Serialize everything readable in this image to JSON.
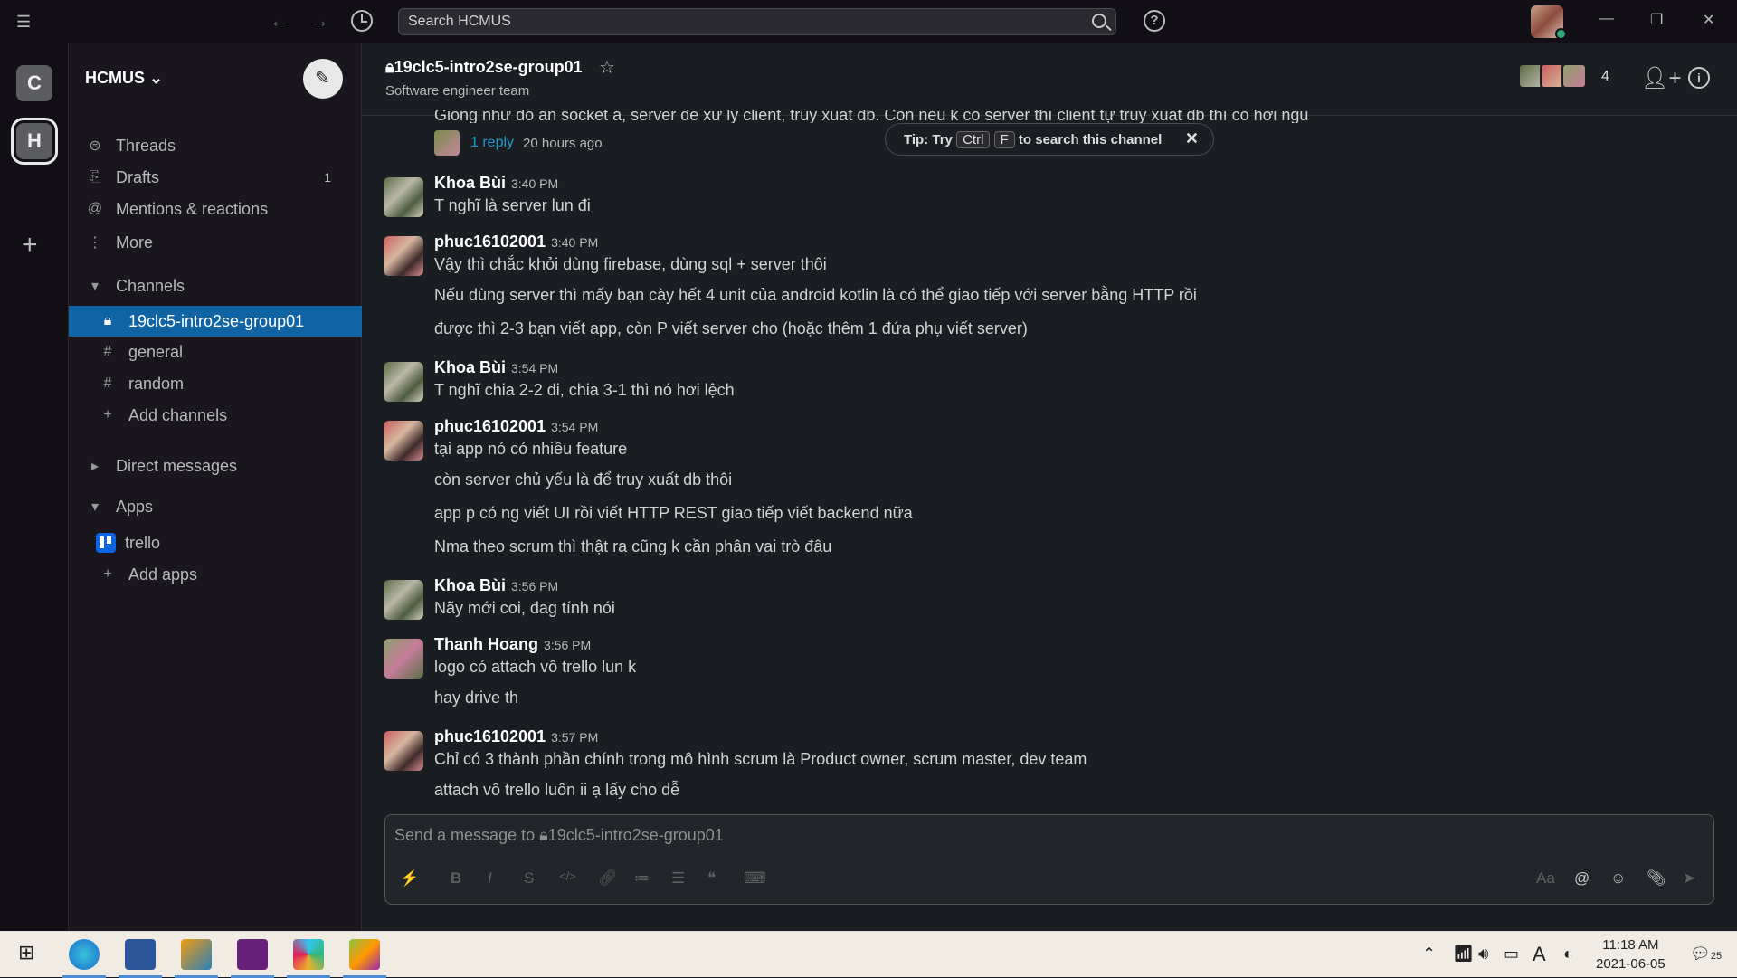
{
  "window": {
    "search_placeholder": "Search HCMUS",
    "nav_back": "←",
    "nav_forward": "→",
    "help": "?",
    "minimize": "—",
    "restore": "❐",
    "close": "✕"
  },
  "rail": {
    "workspaces": [
      {
        "letter": "C"
      },
      {
        "letter": "H",
        "active": true
      }
    ],
    "add": "+"
  },
  "sidebar": {
    "workspace_name": "HCMUS ⌄",
    "nav": [
      {
        "icon": "threads-icon",
        "glyph": "⊜",
        "label": "Threads"
      },
      {
        "icon": "drafts-icon",
        "glyph": "⎘",
        "label": "Drafts",
        "count": "1"
      },
      {
        "icon": "mentions-icon",
        "glyph": "@",
        "label": "Mentions & reactions"
      },
      {
        "icon": "more-icon",
        "glyph": "⋮",
        "label": "More"
      }
    ],
    "channels_header": "Channels",
    "channels": [
      {
        "prefix": "🔒︎",
        "name": "19clc5-intro2se-group01",
        "selected": true
      },
      {
        "prefix": "#",
        "name": "general"
      },
      {
        "prefix": "#",
        "name": "random"
      },
      {
        "prefix": "+",
        "name": "Add channels"
      }
    ],
    "dm_header": "Direct messages",
    "apps_header": "Apps",
    "apps": [
      {
        "name": "trello"
      },
      {
        "name": "Add apps"
      }
    ]
  },
  "channel": {
    "title": "19clc5-intro2se-group01",
    "subtitle": "Software engineer team",
    "member_count": "4",
    "star": "☆"
  },
  "thread_preview": {
    "cut_text": "Giống như đó ấn socket ấ, server để xử lý client, truy xuất db. Còn nếu k có server thì client tự truy xuất db thì có hơi ngu",
    "reply_link": "1 reply",
    "reply_time": "20 hours ago"
  },
  "tip": {
    "prefix": "Tip: Try",
    "key1": "Ctrl",
    "key2": "F",
    "suffix": "to search this channel",
    "close": "✕"
  },
  "messages": [
    {
      "author": "Khoa Bùi",
      "time": "3:40 PM",
      "lines": [
        "T nghĩ là server lun đi"
      ]
    },
    {
      "author": "phuc16102001",
      "time": "3:40 PM",
      "lines": [
        "Vậy thì chắc khỏi dùng firebase, dùng sql + server thôi",
        "Nếu dùng server thì mấy bạn cày hết 4 unit của android kotlin là có thể giao tiếp với server bằng HTTP rồi",
        "được thì 2-3 bạn viết app, còn P viết server cho (hoặc thêm 1 đứa phụ viết server)"
      ]
    },
    {
      "author": "Khoa Bùi",
      "time": "3:54 PM",
      "lines": [
        "T nghĩ chia 2-2 đi, chia 3-1 thì nó hơi lệch"
      ]
    },
    {
      "author": "phuc16102001",
      "time": "3:54 PM",
      "lines": [
        "tại app nó có nhiều feature",
        "còn server chủ yếu là để truy xuất db thôi",
        "app p có ng viết UI rồi viết HTTP REST giao tiếp viết backend nữa",
        "Nma theo scrum thì thật ra cũng k cần phân vai trò đâu"
      ]
    },
    {
      "author": "Khoa Bùi",
      "time": "3:56 PM",
      "lines": [
        "Nãy mới coi, đag tính nói"
      ]
    },
    {
      "author": "Thanh Hoang",
      "time": "3:56 PM",
      "lines": [
        "logo có attach vô trello lun k",
        "hay drive th"
      ]
    },
    {
      "author": "phuc16102001",
      "time": "3:57 PM",
      "lines": [
        "Chỉ có 3 thành phần chính trong mô hình scrum là Product owner, scrum master, dev team",
        "attach vô trello luôn ii ạ lấy cho dễ"
      ]
    }
  ],
  "composer": {
    "placeholder": "Send a message to 🔒︎19clc5-intro2se-group01",
    "tools": [
      "⚡",
      "B",
      "I",
      "S",
      "</>",
      "🔗︎",
      "≔",
      "☰",
      "❝",
      "⌨",
      "Aa",
      "@",
      "☺",
      "📎︎",
      "➤"
    ]
  },
  "taskbar": {
    "time": "11:18 AM",
    "date": "2021-06-05",
    "notif_count": "25",
    "lang": "A"
  },
  "colors": {
    "selected_channel": "#1164a3",
    "link": "#1d9bd1",
    "online": "#2bac76"
  }
}
